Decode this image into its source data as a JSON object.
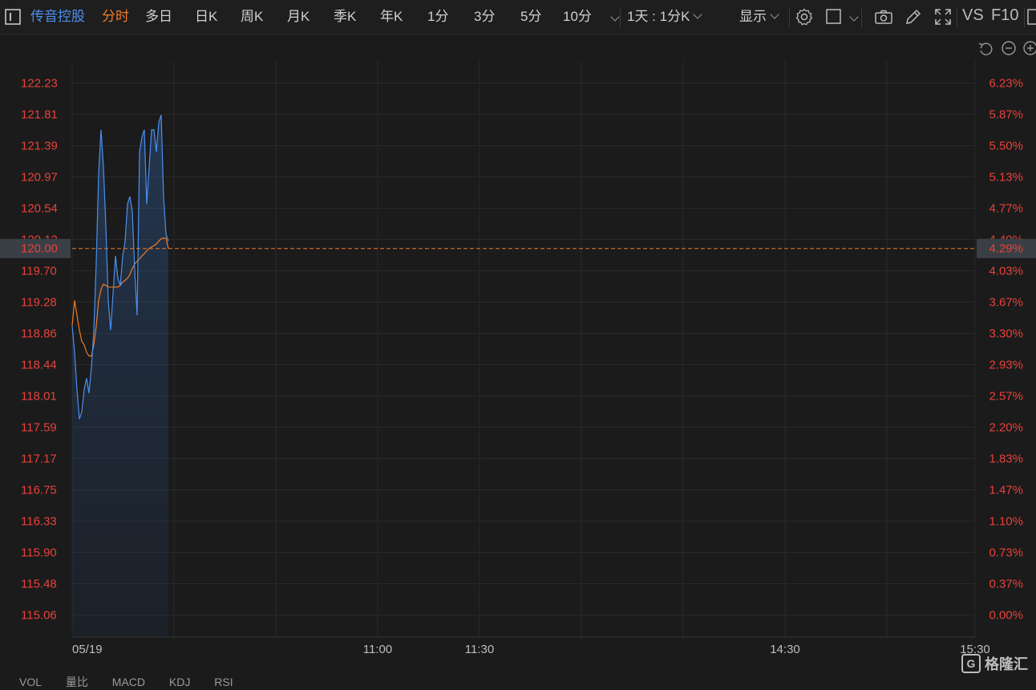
{
  "toolbar": {
    "stock_name": "传音控股",
    "tabs": [
      "分时",
      "多日",
      "日K",
      "周K",
      "月K",
      "季K",
      "年K",
      "1分",
      "3分",
      "5分",
      "10分"
    ],
    "active_tab": "分时",
    "period_selector": "1天 : 1分K",
    "display_label": "显示",
    "vs_label": "VS",
    "f10_label": "F10"
  },
  "colors": {
    "background": "#1b1b1b",
    "price_line": "#4b8ff0",
    "avg_line": "#f07b27",
    "axis_text": "#e8413a",
    "active_tab": "#f07b27",
    "stock_name": "#4b8ff0",
    "grid": "#2a2a2a"
  },
  "current": {
    "price": "120.00",
    "change_pct": "4.29%"
  },
  "chart_data": {
    "type": "line",
    "left_ticks": [
      "122.23",
      "121.81",
      "121.39",
      "120.97",
      "120.54",
      "120.12",
      "119.70",
      "119.28",
      "118.86",
      "118.44",
      "118.01",
      "117.59",
      "117.17",
      "116.75",
      "116.33",
      "115.90",
      "115.48",
      "115.06"
    ],
    "right_ticks": [
      "6.23%",
      "5.87%",
      "5.50%",
      "5.13%",
      "4.77%",
      "4.40%",
      "4.03%",
      "3.67%",
      "3.30%",
      "2.93%",
      "2.57%",
      "2.20%",
      "1.83%",
      "1.47%",
      "1.10%",
      "0.73%",
      "0.37%",
      "0.00%"
    ],
    "x_labels": [
      "05/19",
      "11:00",
      "11:30",
      "14:30",
      "15:30"
    ],
    "ylim": [
      115.06,
      122.23
    ],
    "current_price": 120.0,
    "series": [
      {
        "name": "price",
        "values": [
          118.96,
          118.6,
          118.1,
          117.7,
          117.8,
          118.1,
          118.25,
          118.05,
          118.4,
          118.9,
          119.8,
          121.0,
          121.6,
          121.1,
          120.3,
          119.3,
          118.9,
          119.4,
          119.9,
          119.6,
          119.5,
          119.9,
          120.1,
          120.6,
          120.7,
          120.5,
          119.7,
          119.1,
          121.3,
          121.5,
          121.6,
          120.6,
          121.1,
          121.6,
          121.6,
          121.3,
          121.7,
          121.8,
          120.7,
          120.2,
          120.1
        ],
        "x_start": 0
      },
      {
        "name": "avg",
        "values": [
          118.96,
          119.3,
          119.1,
          118.9,
          118.75,
          118.7,
          118.6,
          118.55,
          118.55,
          118.7,
          118.95,
          119.3,
          119.45,
          119.52,
          119.5,
          119.48,
          119.48,
          119.48,
          119.48,
          119.48,
          119.5,
          119.55,
          119.57,
          119.6,
          119.65,
          119.73,
          119.79,
          119.83,
          119.86,
          119.9,
          119.93,
          119.97,
          120.0,
          120.02,
          120.04,
          120.06,
          120.1,
          120.13,
          120.14,
          120.14,
          120.0
        ],
        "x_start": 0
      }
    ]
  },
  "bottom_tabs": [
    "VOL",
    "量比",
    "MACD",
    "KDJ",
    "RSI"
  ],
  "watermark": "格隆汇"
}
